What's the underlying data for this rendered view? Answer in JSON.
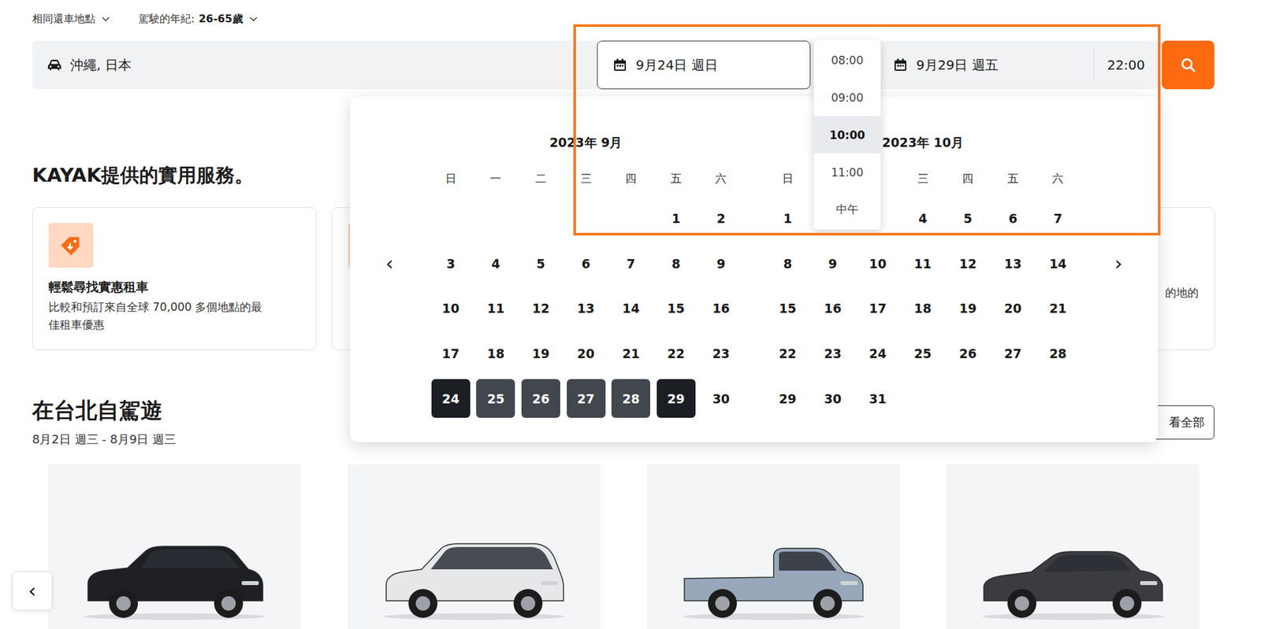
{
  "options": [
    {
      "label": "相同還車地點",
      "value": ""
    },
    {
      "label": "駕駛的年紀: ",
      "value": "26-65歲"
    }
  ],
  "search": {
    "location": "沖繩, 日本",
    "pickup_date": "9月24日 週日",
    "pickup_active": true,
    "dropoff_date": "9月29日 週五",
    "dropoff_time": "22:00"
  },
  "time_dropdown": [
    {
      "label": "08:00",
      "selected": false
    },
    {
      "label": "09:00",
      "selected": false
    },
    {
      "label": "10:00",
      "selected": true
    },
    {
      "label": "11:00",
      "selected": false
    },
    {
      "label": "中午",
      "selected": false
    }
  ],
  "calendar": {
    "prev": "‹",
    "next": "›",
    "months": [
      {
        "title": "2023年 9月",
        "weekdays": [
          "日",
          "一",
          "二",
          "三",
          "四",
          "五",
          "六"
        ],
        "weeks": [
          [
            {
              "day": "",
              "selected": false,
              "endpoint": false
            },
            {
              "day": "",
              "selected": false,
              "endpoint": false
            },
            {
              "day": "",
              "selected": false,
              "endpoint": false
            },
            {
              "day": "",
              "selected": false,
              "endpoint": false
            },
            {
              "day": "",
              "selected": false,
              "endpoint": false
            },
            {
              "day": "1",
              "selected": false,
              "endpoint": false
            },
            {
              "day": "2",
              "selected": false,
              "endpoint": false
            }
          ],
          [
            {
              "day": "3",
              "selected": false,
              "endpoint": false
            },
            {
              "day": "4",
              "selected": false,
              "endpoint": false
            },
            {
              "day": "5",
              "selected": false,
              "endpoint": false
            },
            {
              "day": "6",
              "selected": false,
              "endpoint": false
            },
            {
              "day": "7",
              "selected": false,
              "endpoint": false
            },
            {
              "day": "8",
              "selected": false,
              "endpoint": false
            },
            {
              "day": "9",
              "selected": false,
              "endpoint": false
            }
          ],
          [
            {
              "day": "10",
              "selected": false,
              "endpoint": false
            },
            {
              "day": "11",
              "selected": false,
              "endpoint": false
            },
            {
              "day": "12",
              "selected": false,
              "endpoint": false
            },
            {
              "day": "13",
              "selected": false,
              "endpoint": false
            },
            {
              "day": "14",
              "selected": false,
              "endpoint": false
            },
            {
              "day": "15",
              "selected": false,
              "endpoint": false
            },
            {
              "day": "16",
              "selected": false,
              "endpoint": false
            }
          ],
          [
            {
              "day": "17",
              "selected": false,
              "endpoint": false
            },
            {
              "day": "18",
              "selected": false,
              "endpoint": false
            },
            {
              "day": "19",
              "selected": false,
              "endpoint": false
            },
            {
              "day": "20",
              "selected": false,
              "endpoint": false
            },
            {
              "day": "21",
              "selected": false,
              "endpoint": false
            },
            {
              "day": "22",
              "selected": false,
              "endpoint": false
            },
            {
              "day": "23",
              "selected": false,
              "endpoint": false
            }
          ],
          [
            {
              "day": "24",
              "selected": true,
              "endpoint": true
            },
            {
              "day": "25",
              "selected": true,
              "endpoint": false
            },
            {
              "day": "26",
              "selected": true,
              "endpoint": false
            },
            {
              "day": "27",
              "selected": true,
              "endpoint": false
            },
            {
              "day": "28",
              "selected": true,
              "endpoint": false
            },
            {
              "day": "29",
              "selected": true,
              "endpoint": true
            },
            {
              "day": "30",
              "selected": false,
              "endpoint": false
            }
          ]
        ]
      },
      {
        "title": "2023年 10月",
        "weekdays": [
          "日",
          "",
          "",
          "三",
          "四",
          "五",
          "六"
        ],
        "weeks": [
          [
            {
              "day": "1",
              "selected": false,
              "endpoint": false
            },
            {
              "day": "",
              "selected": false,
              "endpoint": false
            },
            {
              "day": "",
              "selected": false,
              "endpoint": false
            },
            {
              "day": "4",
              "selected": false,
              "endpoint": false
            },
            {
              "day": "5",
              "selected": false,
              "endpoint": false
            },
            {
              "day": "6",
              "selected": false,
              "endpoint": false
            },
            {
              "day": "7",
              "selected": false,
              "endpoint": false
            }
          ],
          [
            {
              "day": "8",
              "selected": false,
              "endpoint": false
            },
            {
              "day": "9",
              "selected": false,
              "endpoint": false
            },
            {
              "day": "10",
              "selected": false,
              "endpoint": false
            },
            {
              "day": "11",
              "selected": false,
              "endpoint": false
            },
            {
              "day": "12",
              "selected": false,
              "endpoint": false
            },
            {
              "day": "13",
              "selected": false,
              "endpoint": false
            },
            {
              "day": "14",
              "selected": false,
              "endpoint": false
            }
          ],
          [
            {
              "day": "15",
              "selected": false,
              "endpoint": false
            },
            {
              "day": "16",
              "selected": false,
              "endpoint": false
            },
            {
              "day": "17",
              "selected": false,
              "endpoint": false
            },
            {
              "day": "18",
              "selected": false,
              "endpoint": false
            },
            {
              "day": "19",
              "selected": false,
              "endpoint": false
            },
            {
              "day": "20",
              "selected": false,
              "endpoint": false
            },
            {
              "day": "21",
              "selected": false,
              "endpoint": false
            }
          ],
          [
            {
              "day": "22",
              "selected": false,
              "endpoint": false
            },
            {
              "day": "23",
              "selected": false,
              "endpoint": false
            },
            {
              "day": "24",
              "selected": false,
              "endpoint": false
            },
            {
              "day": "25",
              "selected": false,
              "endpoint": false
            },
            {
              "day": "26",
              "selected": false,
              "endpoint": false
            },
            {
              "day": "27",
              "selected": false,
              "endpoint": false
            },
            {
              "day": "28",
              "selected": false,
              "endpoint": false
            }
          ],
          [
            {
              "day": "29",
              "selected": false,
              "endpoint": false
            },
            {
              "day": "30",
              "selected": false,
              "endpoint": false
            },
            {
              "day": "31",
              "selected": false,
              "endpoint": false
            },
            {
              "day": "",
              "selected": false,
              "endpoint": false
            },
            {
              "day": "",
              "selected": false,
              "endpoint": false
            },
            {
              "day": "",
              "selected": false,
              "endpoint": false
            },
            {
              "day": "",
              "selected": false,
              "endpoint": false
            }
          ]
        ]
      }
    ]
  },
  "services": {
    "title": "KAYAK提供的實用服務。",
    "cards": [
      {
        "kind": "full",
        "title": "輕鬆尋找實惠租車",
        "lines": [
          "比較和預訂來自全球 70,000 多個地點的最",
          "佳租車優惠"
        ]
      },
      {
        "kind": "covered",
        "title": "",
        "lines": []
      },
      {
        "kind": "covered",
        "title": "",
        "lines": []
      },
      {
        "kind": "clipped",
        "title": "",
        "lines": [
          "的地的"
        ]
      }
    ]
  },
  "road_trip": {
    "title": "在台北自駕遊",
    "dates": "8月2日 週三 - 8月9日 週三",
    "see_all": "看全部",
    "prev": "‹",
    "cars": [
      {
        "kind": "suv",
        "color": "#1f2023"
      },
      {
        "kind": "minivan",
        "color": "#e6e7e9"
      },
      {
        "kind": "pickup",
        "color": "#98a8ba"
      },
      {
        "kind": "sedan",
        "color": "#3b3c40"
      }
    ]
  }
}
